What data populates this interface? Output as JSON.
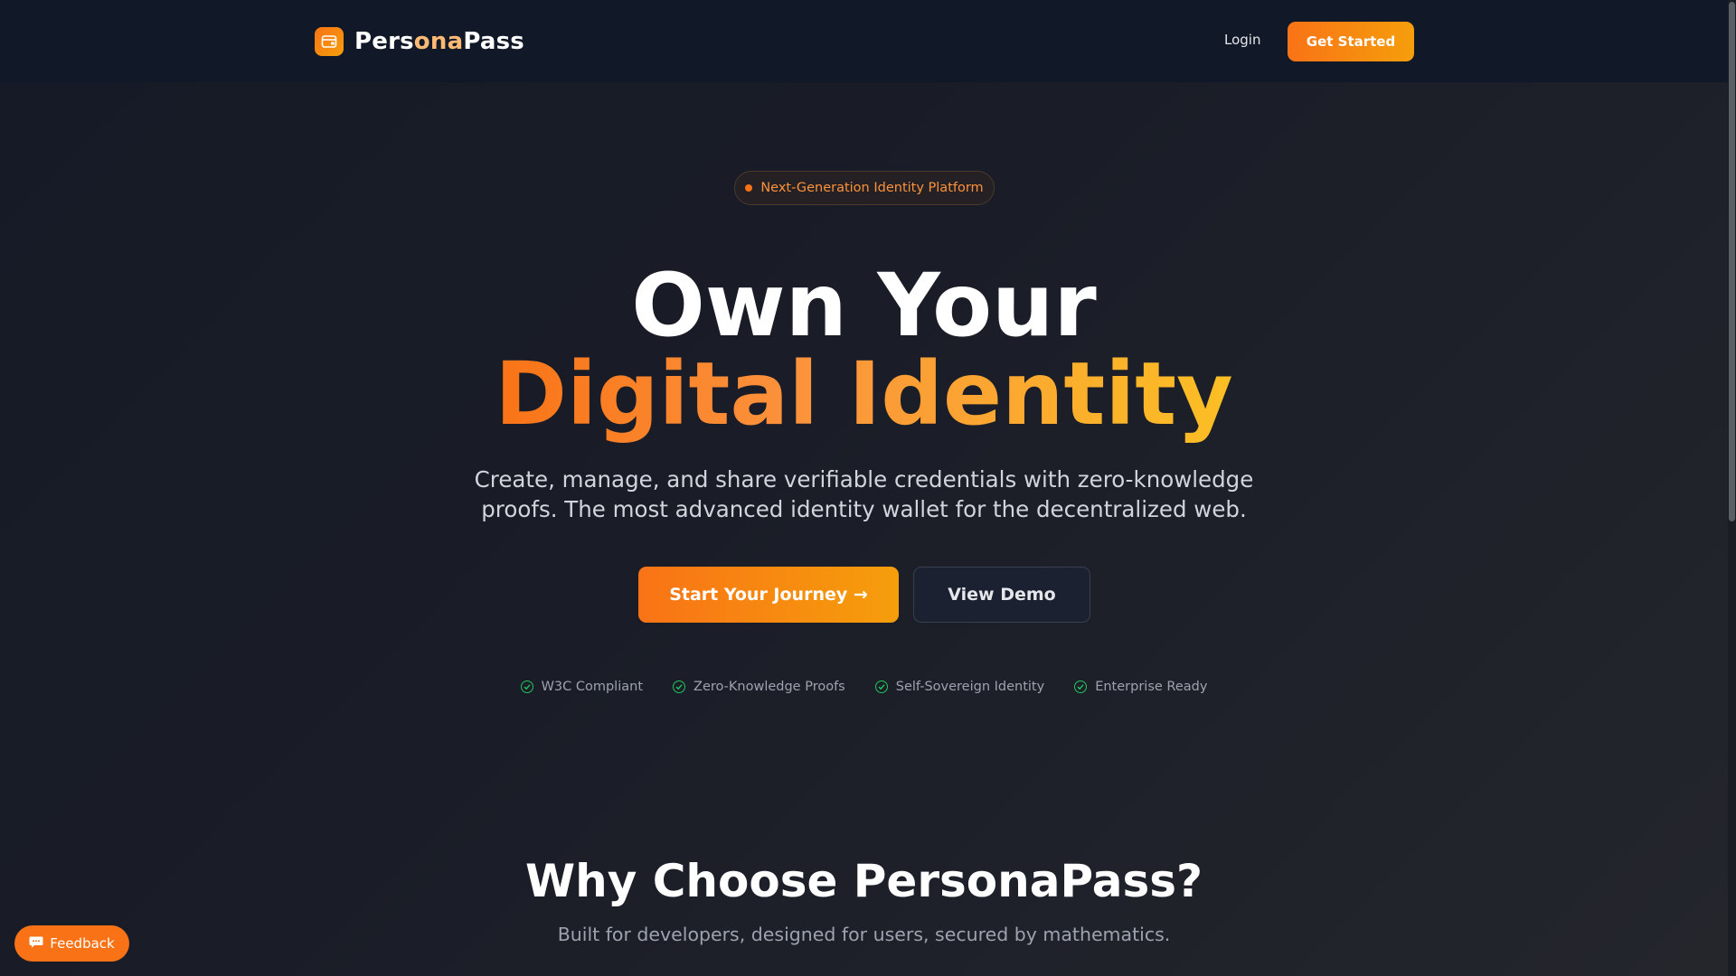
{
  "header": {
    "brand": {
      "part1": "Pers",
      "part2": "ona",
      "part3": "Pass",
      "logo_icon": "wallet-icon"
    },
    "login_label": "Login",
    "cta_label": "Get Started"
  },
  "hero": {
    "badge": "Next-Generation Identity Platform",
    "title_line1": "Own Your",
    "title_line2": "Digital Identity",
    "subtitle": "Create, manage, and share verifiable credentials with zero-knowledge proofs. The most advanced identity wallet for the decentralized web.",
    "primary_button": "Start Your Journey →",
    "secondary_button": "View Demo",
    "features": [
      {
        "label": "W3C Compliant",
        "icon": "check-circle-icon"
      },
      {
        "label": "Zero-Knowledge Proofs",
        "icon": "check-circle-icon"
      },
      {
        "label": "Self-Sovereign Identity",
        "icon": "check-circle-icon"
      },
      {
        "label": "Enterprise Ready",
        "icon": "check-circle-icon"
      }
    ]
  },
  "why_section": {
    "title": "Why Choose PersonaPass?",
    "subtitle": "Built for developers, designed for users, secured by mathematics."
  },
  "feedback": {
    "label": "Feedback",
    "icon": "chat-bubble-icon"
  },
  "colors": {
    "accent": "#f97316",
    "accent_end": "#f59e0b",
    "header_bg": "#111827",
    "check": "#22c55e"
  }
}
